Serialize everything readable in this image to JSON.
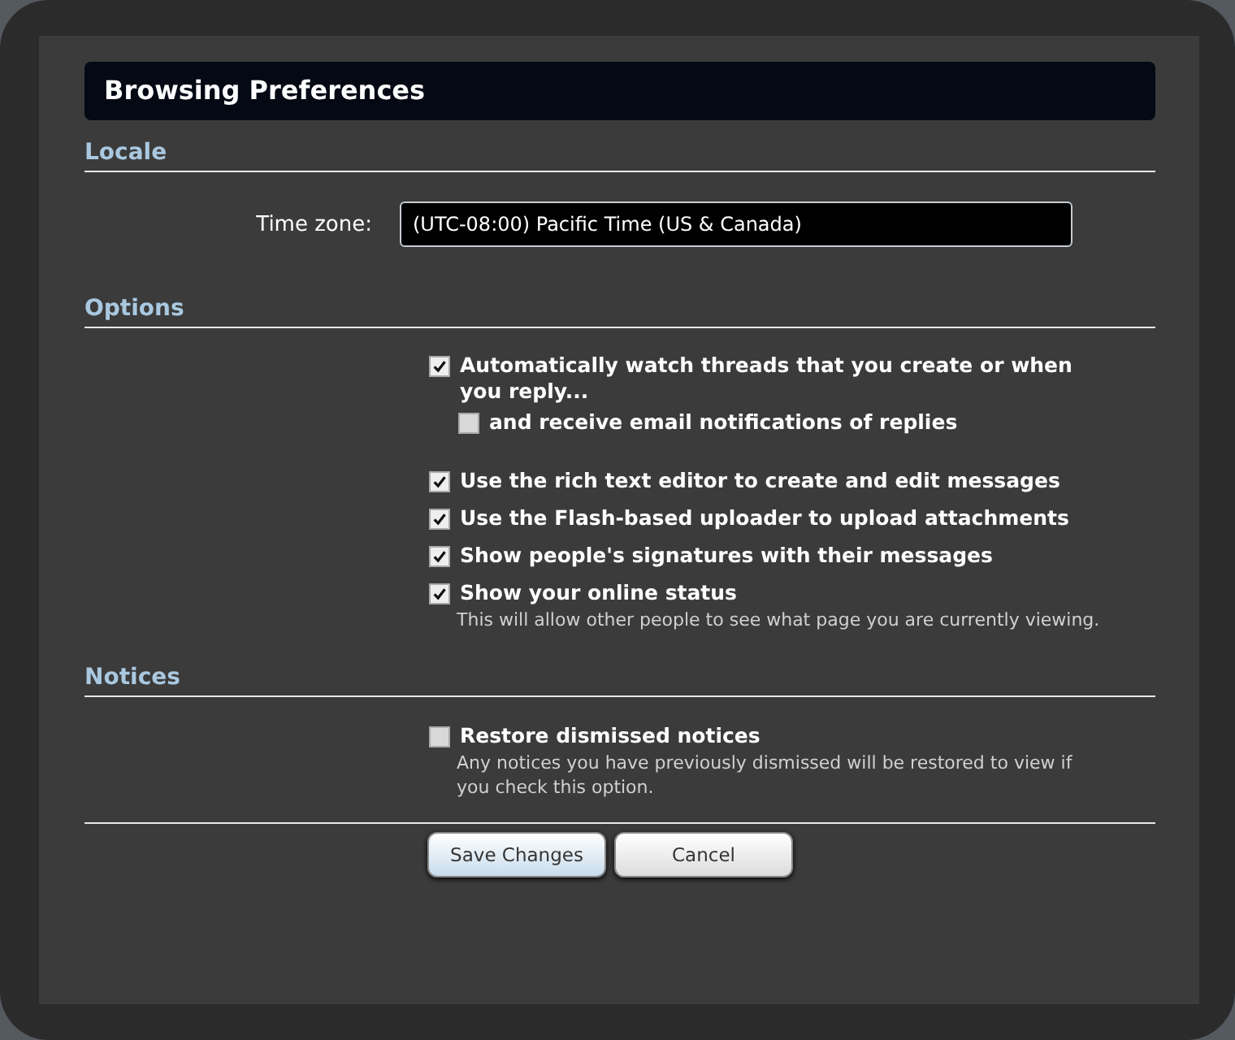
{
  "dialog": {
    "title": "Browsing Preferences"
  },
  "locale": {
    "heading": "Locale",
    "time_zone": {
      "label": "Time zone:",
      "value": "(UTC-08:00) Pacific Time (US & Canada)"
    }
  },
  "options": {
    "heading": "Options",
    "items": [
      {
        "label": "Automatically watch threads that you create or when you reply...",
        "checked": true,
        "children": [
          {
            "label": "and receive email notifications of replies",
            "checked": false
          }
        ]
      },
      {
        "label": "Use the rich text editor to create and edit messages",
        "checked": true
      },
      {
        "label": "Use the Flash-based uploader to upload attachments",
        "checked": true
      },
      {
        "label": "Show people's signatures with their messages",
        "checked": true
      },
      {
        "label": "Show your online status",
        "checked": true,
        "hint": "This will allow other people to see what page you are currently viewing."
      }
    ]
  },
  "notices": {
    "heading": "Notices",
    "items": [
      {
        "label": "Restore dismissed notices",
        "checked": false,
        "hint": "Any notices you have previously dismissed will be restored to view if you check this option."
      }
    ]
  },
  "buttons": [
    {
      "label": "Save Changes",
      "kind": "primary"
    },
    {
      "label": "Cancel",
      "kind": "secondary"
    }
  ]
}
